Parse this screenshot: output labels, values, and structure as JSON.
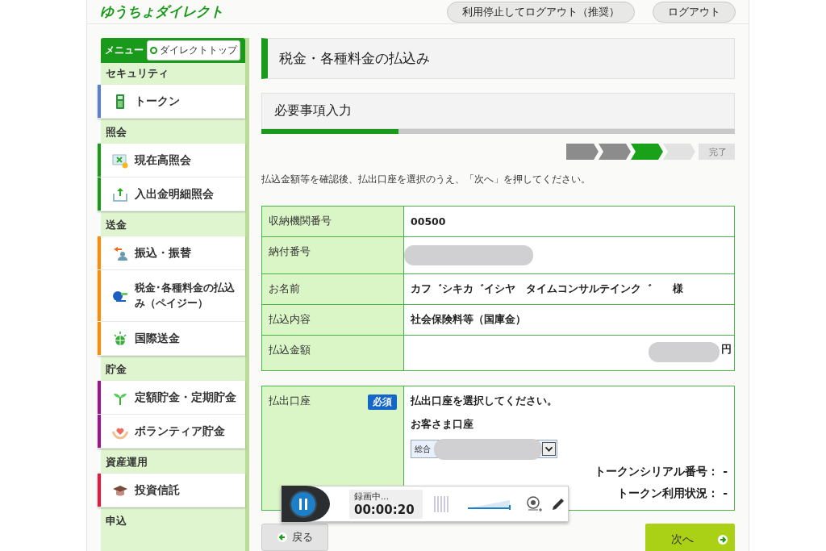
{
  "header": {
    "logo": "ゆうちょダイレクト",
    "buttons": [
      "利用停止してログアウト（推奨）",
      "ログアウト"
    ]
  },
  "sidebar": {
    "title": "メニュー",
    "top_link": "ダイレクトトップ",
    "sections": [
      {
        "heading": "セキュリティ",
        "items": [
          {
            "label": "トークン",
            "color": "#5b7fd6"
          }
        ]
      },
      {
        "heading": "照会",
        "items": [
          {
            "label": "現在高照会",
            "color": "#1a9a1a"
          },
          {
            "label": "入出金明細照会",
            "color": "#1a9a1a"
          }
        ]
      },
      {
        "heading": "送金",
        "items": [
          {
            "label": "振込・振替",
            "color": "#ff8c00"
          },
          {
            "label": "税金･各種料金の払込み（ペイジー）",
            "color": "#ff8c00"
          },
          {
            "label": "国際送金",
            "color": "#ff8c00"
          }
        ]
      },
      {
        "heading": "貯金",
        "items": [
          {
            "label": "定額貯金・定期貯金",
            "color": "#a0128f"
          },
          {
            "label": "ボランティア貯金",
            "color": "#a0128f"
          }
        ]
      },
      {
        "heading": "資産運用",
        "items": [
          {
            "label": "投資信託",
            "color": "#f0143c"
          }
        ]
      },
      {
        "heading": "申込"
      }
    ]
  },
  "main": {
    "title": "税金・各種料金の払込み",
    "section_title": "必要事項入力",
    "progress": {
      "level": 0.29
    },
    "steps": [
      {
        "kind": "chevron",
        "completed": true,
        "current": false
      },
      {
        "kind": "chevron",
        "completed": true,
        "current": false
      },
      {
        "kind": "chevron",
        "completed": false,
        "current": true
      },
      {
        "kind": "chevron",
        "completed": false,
        "current": false
      },
      {
        "kind": "label",
        "label": "完了"
      }
    ],
    "instruction": "払込金額等を確認後、払出口座を選択のうえ、「次へ」を押してください。",
    "details": [
      {
        "label": "収納機関番号",
        "kind": "text",
        "value": "00500"
      },
      {
        "label": "納付番号",
        "kind": "redacted"
      },
      {
        "label": "お名前",
        "kind": "text",
        "value": "カフ゛シキカ゛イシヤ　タイムコンサルテインク゛　　様"
      },
      {
        "label": "払込内容",
        "kind": "text",
        "value": "社会保険料等（国庫金）"
      },
      {
        "label": "払込金額",
        "kind": "amount",
        "value": "円"
      }
    ],
    "payment": {
      "label": "払出口座",
      "badge": "必須",
      "prompt": "払出口座を選択してください。",
      "account_label": "お客さま口座",
      "select": {
        "value": "総合"
      },
      "token_lines": [
        "トークンシリアル番号：  -",
        "トークン利用状況：  -"
      ]
    },
    "back_button": "戻る",
    "next_button": "次へ"
  },
  "recorder": {
    "status": "録画中...",
    "time": "00:00:20"
  }
}
